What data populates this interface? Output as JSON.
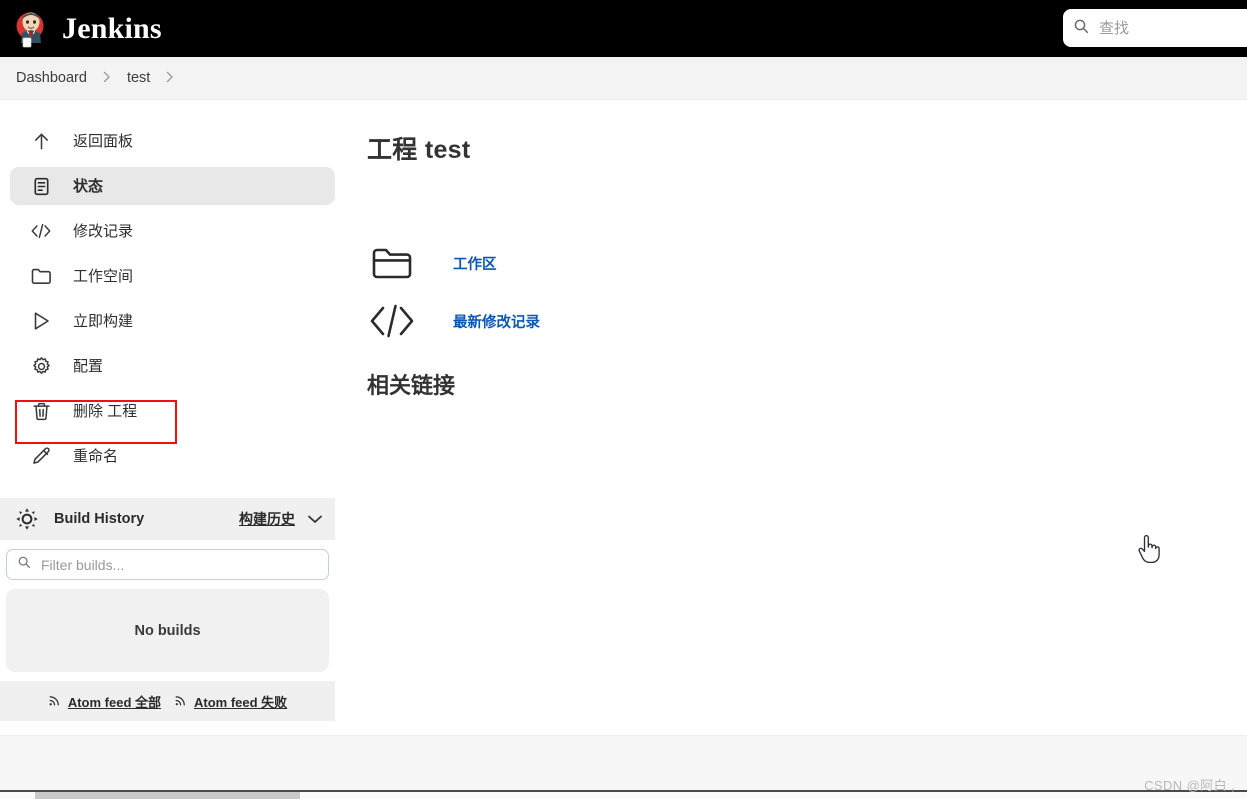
{
  "header": {
    "brand_title": "Jenkins",
    "logo_icon": "jenkins-butler-logo",
    "search": {
      "icon": "search-icon",
      "placeholder": "查找",
      "value": ""
    }
  },
  "breadcrumb": {
    "items": [
      {
        "label": "Dashboard"
      },
      {
        "label": "test"
      }
    ],
    "separator": "›"
  },
  "sidebar": {
    "items": [
      {
        "label": "返回面板",
        "icon": "arrow-up-icon",
        "active": false
      },
      {
        "label": "状态",
        "icon": "document-status-icon",
        "active": true
      },
      {
        "label": "修改记录",
        "icon": "code-brackets-icon",
        "active": false
      },
      {
        "label": "工作空间",
        "icon": "folder-icon",
        "active": false
      },
      {
        "label": "立即构建",
        "icon": "play-triangle-icon",
        "active": false
      },
      {
        "label": "配置",
        "icon": "gear-icon",
        "active": false
      },
      {
        "label": "删除 工程",
        "icon": "trash-icon",
        "active": false
      },
      {
        "label": "重命名",
        "icon": "pencil-icon",
        "active": false
      }
    ],
    "annotation": {
      "color": "#f40f0f",
      "target": "立即构建"
    }
  },
  "build_history": {
    "icon": "build-status-sun-icon",
    "title": "Build History",
    "link_label": "构建历史",
    "chevron_icon": "chevron-down-icon",
    "filter": {
      "icon": "search-icon",
      "placeholder": "Filter builds...",
      "value": ""
    },
    "empty_text": "No builds",
    "feeds": [
      {
        "icon": "rss-icon",
        "label": "Atom feed 全部"
      },
      {
        "icon": "rss-icon",
        "label": "Atom feed 失败"
      }
    ]
  },
  "main": {
    "page_title": "工程 test",
    "links": [
      {
        "label": "工作区",
        "icon": "folder-icon"
      },
      {
        "label": "最新修改记录",
        "icon": "code-brackets-icon"
      }
    ],
    "section_title": "相关链接"
  },
  "watermark": {
    "text": "CSDN @阿白 ,"
  },
  "colors": {
    "header_bg": "#000000",
    "link_blue": "#0b57b8",
    "annotation_red": "#f40f0f",
    "active_nav_bg": "#e8e8e8",
    "panel_gray": "#f0f0f0"
  }
}
